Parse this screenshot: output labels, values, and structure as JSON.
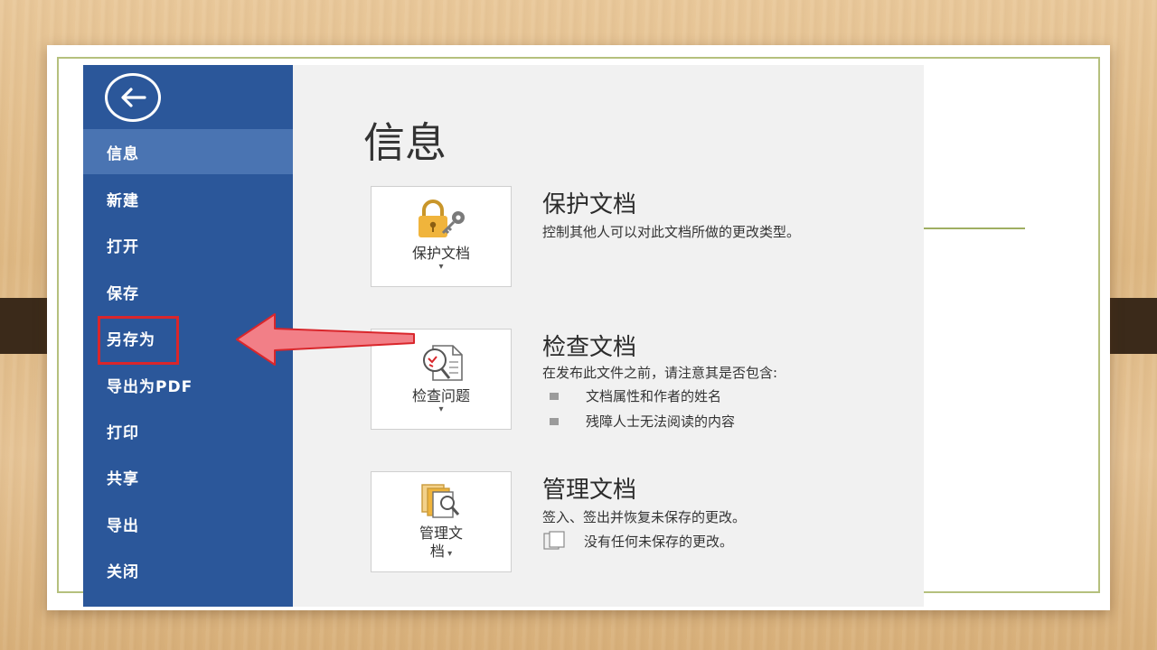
{
  "sidebar": {
    "back_icon": "back-arrow-icon",
    "items": [
      {
        "label": "信息",
        "active": true
      },
      {
        "label": "新建"
      },
      {
        "label": "打开"
      },
      {
        "label": "保存"
      },
      {
        "label": "另存为",
        "highlighted": true
      },
      {
        "label": "导出为PDF"
      },
      {
        "label": "打印"
      },
      {
        "label": "共享"
      },
      {
        "label": "导出"
      },
      {
        "label": "关闭"
      }
    ]
  },
  "main": {
    "title": "信息",
    "sections": [
      {
        "button_label": "保护文档",
        "button_icon": "lock-key-icon",
        "title": "保护文档",
        "description": "控制其他人可以对此文档所做的更改类型。"
      },
      {
        "button_label": "检查问题",
        "button_icon": "inspect-document-icon",
        "title": "检查文档",
        "description": "在发布此文件之前，请注意其是否包含:",
        "bullets": [
          "文档属性和作者的姓名",
          "残障人士无法阅读的内容"
        ]
      },
      {
        "button_label_line1": "管理文",
        "button_label_line2": "档",
        "button_icon": "manage-document-icon",
        "title": "管理文档",
        "description": "签入、签出并恢复未保存的更改。",
        "note": "没有任何未保存的更改。"
      }
    ]
  },
  "colors": {
    "sidebar": "#2b579a",
    "sidebar_active": "#4a74b2",
    "highlight_box": "#d9262b",
    "callout_arrow": "#f27f87",
    "frame_line": "#b5c07d"
  }
}
